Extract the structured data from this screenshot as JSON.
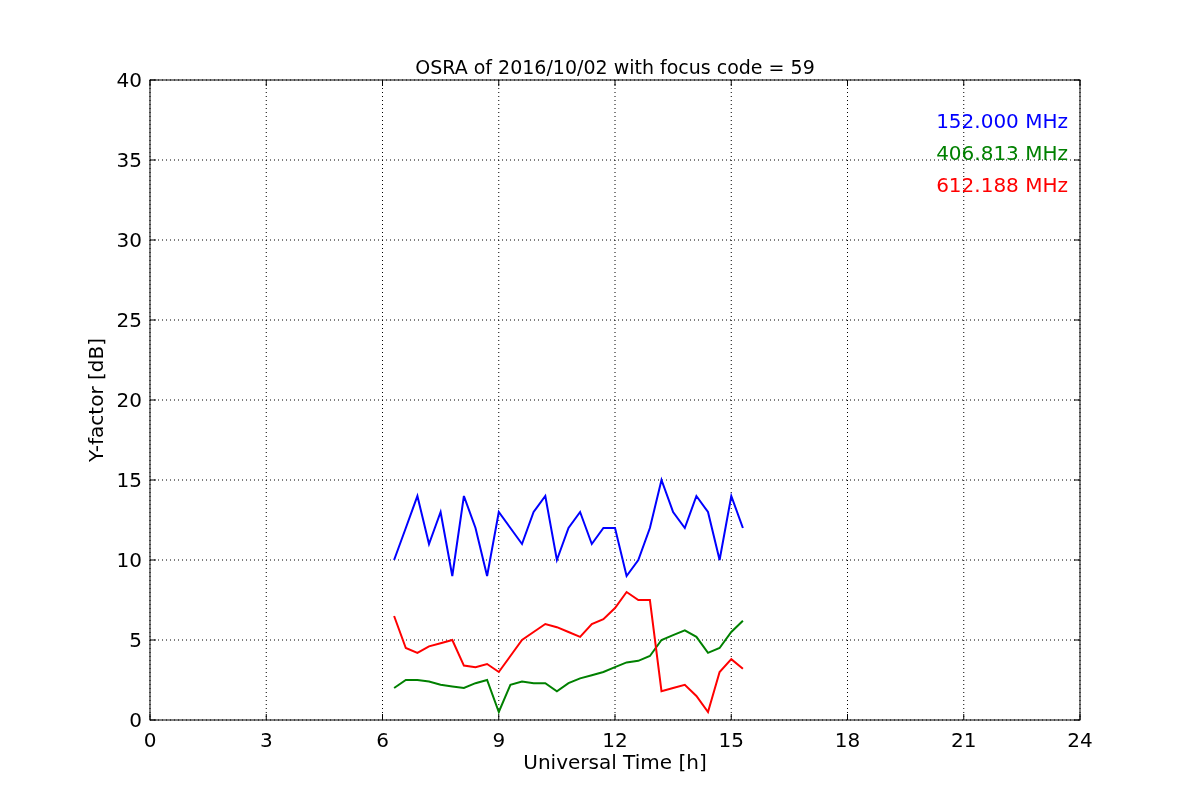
{
  "chart_data": {
    "type": "line",
    "title": "OSRA of 2016/10/02 with focus code = 59",
    "xlabel": "Universal Time [h]",
    "ylabel": "Y-factor [dB]",
    "xlim": [
      0,
      24
    ],
    "ylim": [
      0,
      40
    ],
    "xticks": [
      0,
      3,
      6,
      9,
      12,
      15,
      18,
      21,
      24
    ],
    "yticks": [
      0,
      5,
      10,
      15,
      20,
      25,
      30,
      35,
      40
    ],
    "grid": true,
    "x": [
      6.3,
      6.6,
      6.9,
      7.2,
      7.5,
      7.8,
      8.1,
      8.4,
      8.7,
      9.0,
      9.3,
      9.6,
      9.9,
      10.2,
      10.5,
      10.8,
      11.1,
      11.4,
      11.7,
      12.0,
      12.3,
      12.6,
      12.9,
      13.2,
      13.5,
      13.8,
      14.1,
      14.4,
      14.7,
      15.0,
      15.3
    ],
    "series": [
      {
        "name": "152.000 MHz",
        "color": "#0000ff",
        "values": [
          10,
          12,
          14,
          11,
          13,
          9,
          14,
          12,
          9,
          13,
          12,
          11,
          13,
          14,
          10,
          12,
          13,
          11,
          12,
          12,
          9,
          10,
          12,
          15,
          13,
          12,
          14,
          13,
          10,
          14,
          12
        ]
      },
      {
        "name": "406.813 MHz",
        "color": "#008000",
        "values": [
          2,
          2.5,
          2.5,
          2.4,
          2.2,
          2.1,
          2,
          2.3,
          2.5,
          0.5,
          2.2,
          2.4,
          2.3,
          2.3,
          1.8,
          2.3,
          2.6,
          2.8,
          3,
          3.3,
          3.6,
          3.7,
          4,
          5,
          5.3,
          5.6,
          5.2,
          4.2,
          4.5,
          5.5,
          6.2
        ]
      },
      {
        "name": "612.188 MHz",
        "color": "#ff0000",
        "values": [
          6.5,
          4.5,
          4.2,
          4.6,
          4.8,
          5,
          3.4,
          3.3,
          3.5,
          3,
          4,
          5,
          5.5,
          6,
          5.8,
          5.5,
          5.2,
          6,
          6.3,
          7,
          8,
          7.5,
          7.5,
          1.8,
          2,
          2.2,
          1.5,
          0.5,
          3,
          3.8,
          3.2
        ]
      }
    ]
  }
}
